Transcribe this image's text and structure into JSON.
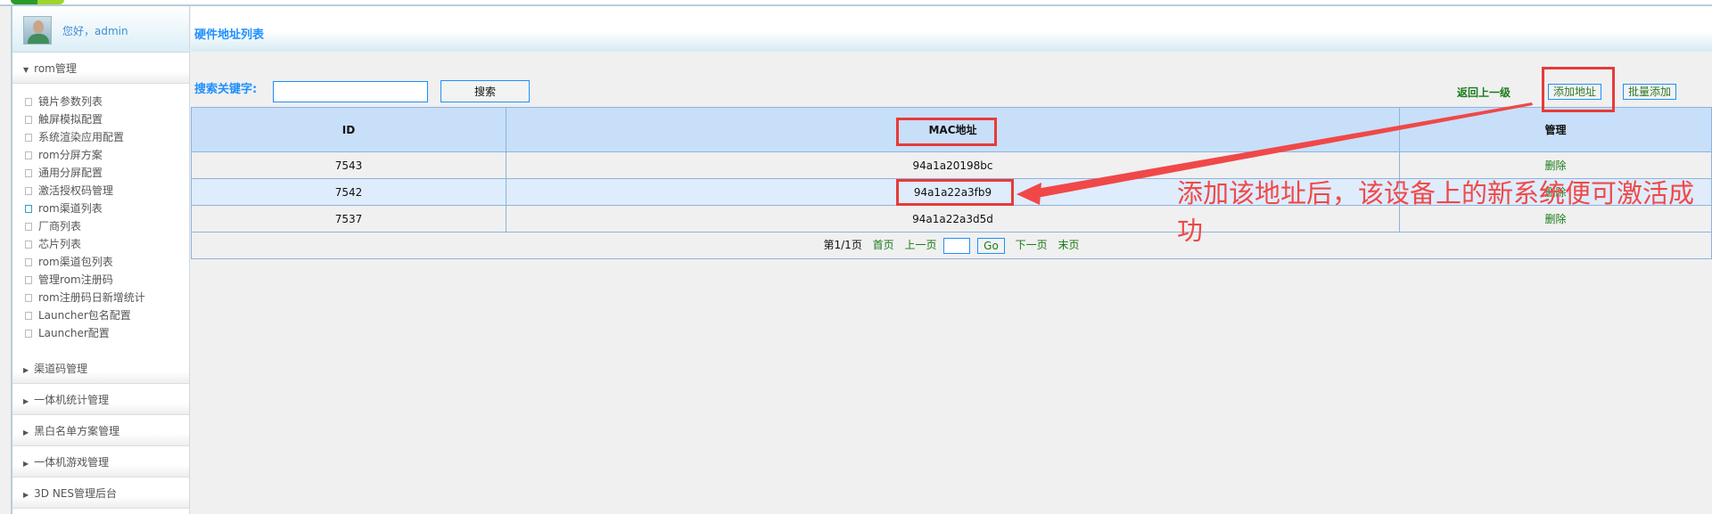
{
  "sidebar": {
    "greeting": "您好，admin",
    "open_group": "rom管理",
    "items": [
      "镜片参数列表",
      "触屏模拟配置",
      "系统渲染应用配置",
      "rom分屏方案",
      "通用分屏配置",
      "激活授权码管理",
      "rom渠道列表",
      "厂商列表",
      "芯片列表",
      "rom渠道包列表",
      "管理rom注册码",
      "rom注册码日新增统计",
      "Launcher包名配置",
      "Launcher配置"
    ],
    "active_item": "rom渠道列表",
    "groups": [
      "渠道码管理",
      "一体机统计管理",
      "黑白名单方案管理",
      "一体机游戏管理",
      "3D NES管理后台"
    ]
  },
  "main": {
    "title": "硬件地址列表",
    "search_label": "搜索关键字:",
    "search_value": "",
    "search_button": "搜索",
    "back_link": "返回上一级",
    "add_button": "添加地址",
    "batch_button": "批量添加",
    "table": {
      "headers": [
        "ID",
        "MAC地址",
        "管理"
      ],
      "rows": [
        {
          "id": "7543",
          "mac": "94a1a20198bc",
          "action": "删除"
        },
        {
          "id": "7542",
          "mac": "94a1a22a3fb9",
          "action": "删除"
        },
        {
          "id": "7537",
          "mac": "94a1a22a3d5d",
          "action": "删除"
        }
      ]
    },
    "pager": {
      "info": "第1/1页",
      "first": "首页",
      "prev": "上一页",
      "go": "Go",
      "next": "下一页",
      "last": "末页",
      "page_input": ""
    }
  },
  "annotation": {
    "text": "添加该地址后，该设备上的新系统便可激活成功",
    "color": "#e83a3a"
  }
}
